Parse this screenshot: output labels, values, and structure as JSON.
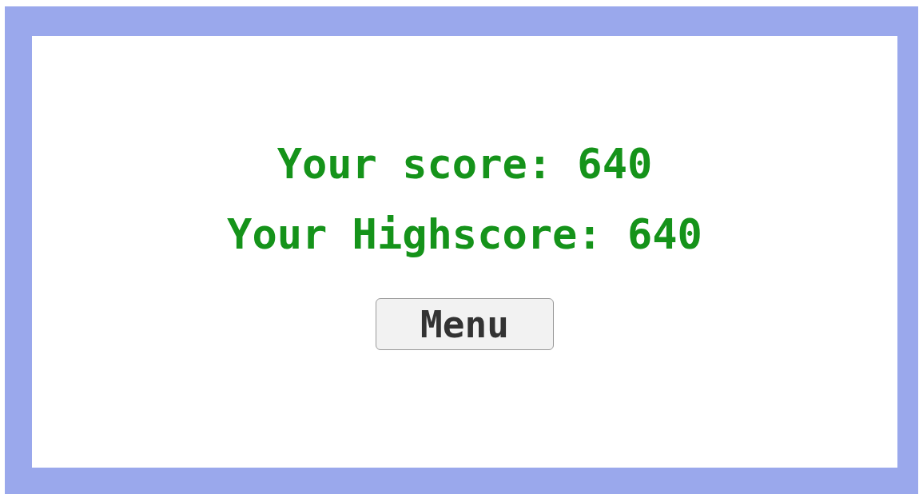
{
  "score_line": "Your score: 640",
  "highscore_line": "Your Highscore: 640",
  "menu_button": "Menu"
}
